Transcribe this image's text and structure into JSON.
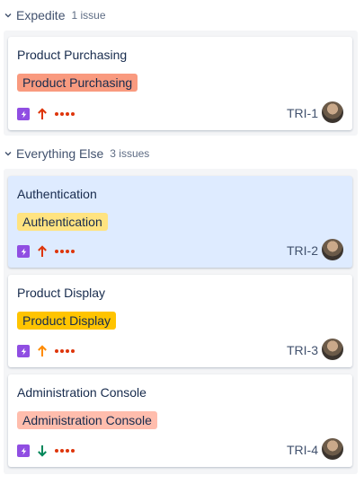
{
  "lanes": [
    {
      "title": "Expedite",
      "count": "1 issue",
      "cards": [
        {
          "title": "Product Purchasing",
          "epic": "Product Purchasing",
          "epic_bg": "#f99a7f",
          "epic_color": "#172b4d",
          "type_icon": "lightning-icon",
          "priority_icon": "arrow-up-icon",
          "priority_color": "#de350b",
          "key": "TRI-1"
        }
      ]
    },
    {
      "title": "Everything Else",
      "count": "3 issues",
      "cards": [
        {
          "title": "Authentication",
          "epic": "Authentication",
          "epic_bg": "#ffe380",
          "epic_color": "#172b4d",
          "type_icon": "lightning-icon",
          "priority_icon": "arrow-up-icon",
          "priority_color": "#de350b",
          "key": "TRI-2",
          "selected": true
        },
        {
          "title": "Product Display",
          "epic": "Product Display",
          "epic_bg": "#ffc400",
          "epic_color": "#172b4d",
          "type_icon": "lightning-icon",
          "priority_icon": "arrow-up-icon",
          "priority_color": "#ff8b00",
          "key": "TRI-3"
        },
        {
          "title": "Administration Console",
          "epic": "Administration Console",
          "epic_bg": "#ffbdad",
          "epic_color": "#172b4d",
          "type_icon": "lightning-icon",
          "priority_icon": "arrow-down-icon",
          "priority_color": "#00875a",
          "key": "TRI-4"
        }
      ]
    }
  ]
}
